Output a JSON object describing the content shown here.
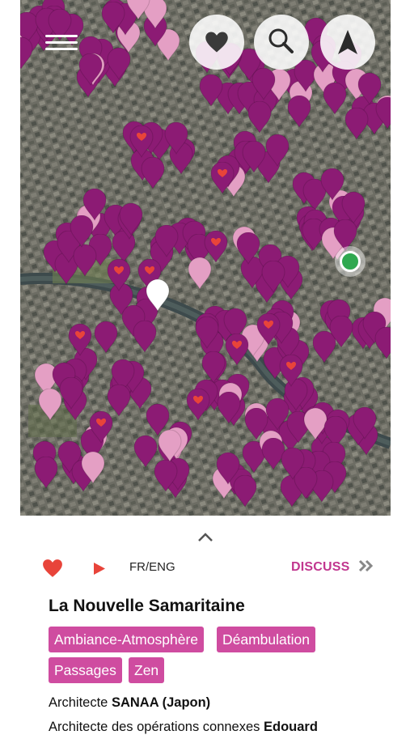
{
  "map": {
    "colors": {
      "pin_dark": "#8c1b74",
      "pin_light": "#e49fc4",
      "pin_white": "#ffffff",
      "heart": "#e8443a",
      "location": "#2fa84f"
    }
  },
  "header": {
    "menu_icon": "hamburger-menu-icon",
    "favorites_icon": "heart-icon",
    "search_icon": "magnifier-icon",
    "locate_icon": "navigation-arrow-icon"
  },
  "sheet": {
    "expand_icon": "chevron-up-icon",
    "favorite_icon": "heart-icon",
    "play_icon": "play-icon",
    "language": "FR/ENG",
    "discuss": "DISCUSS",
    "title": "La Nouvelle Samaritaine",
    "tags": [
      "Ambiance-Atmosphère",
      "Déambulation",
      "Passages",
      "Zen"
    ],
    "architect_prefix": "Architecte ",
    "architect_name": "SANAA (Japon)",
    "operations_prefix": "Architecte des opérations connexes ",
    "operations_name": "Edouard"
  },
  "colors": {
    "accent": "#cf4ca0",
    "accent_text": "#c1378f",
    "heart": "#e8443a",
    "play": "#e8443a"
  }
}
